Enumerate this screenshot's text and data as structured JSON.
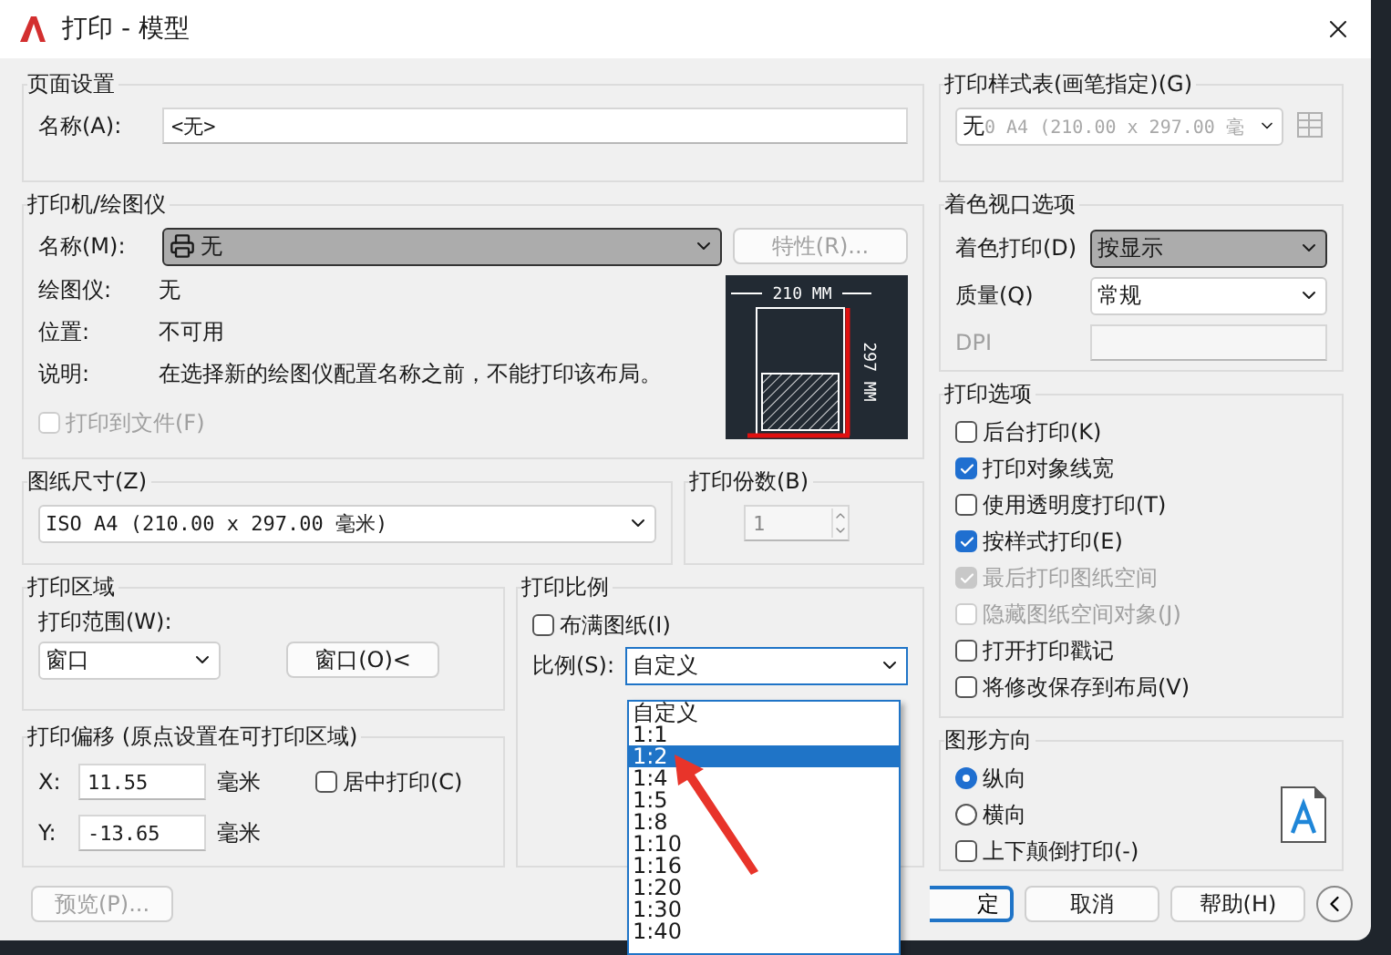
{
  "window": {
    "title": "打印 - 模型"
  },
  "page_setup": {
    "title": "页面设置",
    "name_label": "名称(A):",
    "name_value": "<无>"
  },
  "printer": {
    "title": "打印机/绘图仪",
    "name_label": "名称(M):",
    "name_value": "无",
    "properties_button": {
      "label": "特性(R)...",
      "disabled": true
    },
    "info": [
      {
        "label": "绘图仪:",
        "value": "无"
      },
      {
        "label": "位置:",
        "value": "不可用"
      },
      {
        "label": "说明:",
        "value": "在选择新的绘图仪配置名称之前，不能打印该布局。"
      }
    ],
    "print_to_file": {
      "label": "打印到文件(F)",
      "checked": false,
      "disabled": true
    },
    "preview": {
      "width_label": "210 MM",
      "height_label": "297 MM"
    }
  },
  "paper_size": {
    "title": "图纸尺寸(Z)",
    "value": "ISO A4 (210.00 x 297.00 毫米)"
  },
  "copies": {
    "title": "打印份数(B)",
    "value": "1"
  },
  "print_area": {
    "title": "打印区域",
    "range_label": "打印范围(W):",
    "range_value": "窗口",
    "window_button": "窗口(O)<"
  },
  "print_offset": {
    "title": "打印偏移 (原点设置在可打印区域)",
    "fields": [
      {
        "label": "X:",
        "value": "11.55",
        "unit": "毫米"
      },
      {
        "label": "Y:",
        "value": "-13.65",
        "unit": "毫米"
      }
    ],
    "center": {
      "label": "居中打印(C)",
      "checked": false
    }
  },
  "print_scale": {
    "title": "打印比例",
    "fit": {
      "label": "布满图纸(I)",
      "checked": false
    },
    "scale_label": "比例(S):",
    "scale_value": "自定义",
    "options": [
      {
        "label": "自定义",
        "selected": false
      },
      {
        "label": "1:1",
        "selected": false
      },
      {
        "label": "1:2",
        "selected": true
      },
      {
        "label": "1:4",
        "selected": false
      },
      {
        "label": "1:5",
        "selected": false
      },
      {
        "label": "1:8",
        "selected": false
      },
      {
        "label": "1:10",
        "selected": false
      },
      {
        "label": "1:16",
        "selected": false
      },
      {
        "label": "1:20",
        "selected": false
      },
      {
        "label": "1:30",
        "selected": false
      },
      {
        "label": "1:40",
        "selected": false
      }
    ]
  },
  "style_table": {
    "title": "打印样式表(画笔指定)(G)",
    "value": "无",
    "ghost_text": "0 A4 (210.00 x 297.00 毫"
  },
  "shaded_viewport": {
    "title": "着色视口选项",
    "rows": [
      {
        "kind": "select",
        "label": "着色打印(D)",
        "value": "按显示",
        "highlighted": true
      },
      {
        "kind": "select",
        "label": "质量(Q)",
        "value": "常规",
        "highlighted": false
      },
      {
        "kind": "input",
        "label": "DPI"
      }
    ]
  },
  "print_options": {
    "title": "打印选项",
    "items": [
      {
        "label": "后台打印(K)",
        "checked": false,
        "disabled": false
      },
      {
        "label": "打印对象线宽",
        "checked": true,
        "disabled": false
      },
      {
        "label": "使用透明度打印(T)",
        "checked": false,
        "disabled": false
      },
      {
        "label": "按样式打印(E)",
        "checked": true,
        "disabled": false
      },
      {
        "label": "最后打印图纸空间",
        "checked": true,
        "disabled": true
      },
      {
        "label": "隐藏图纸空间对象(J)",
        "checked": false,
        "disabled": true
      },
      {
        "label": "打开打印戳记",
        "checked": false,
        "disabled": false
      },
      {
        "label": "将修改保存到布局(V)",
        "checked": false,
        "disabled": false
      }
    ]
  },
  "orientation": {
    "title": "图形方向",
    "choices": [
      {
        "label": "纵向",
        "selected": true
      },
      {
        "label": "横向",
        "selected": false
      }
    ],
    "upside_down": {
      "label": "上下颠倒打印(-)",
      "checked": false
    }
  },
  "buttons": {
    "preview": {
      "label": "预览(P)...",
      "disabled": true
    },
    "ok": "定",
    "cancel": "取消",
    "help": "帮助(H)"
  }
}
